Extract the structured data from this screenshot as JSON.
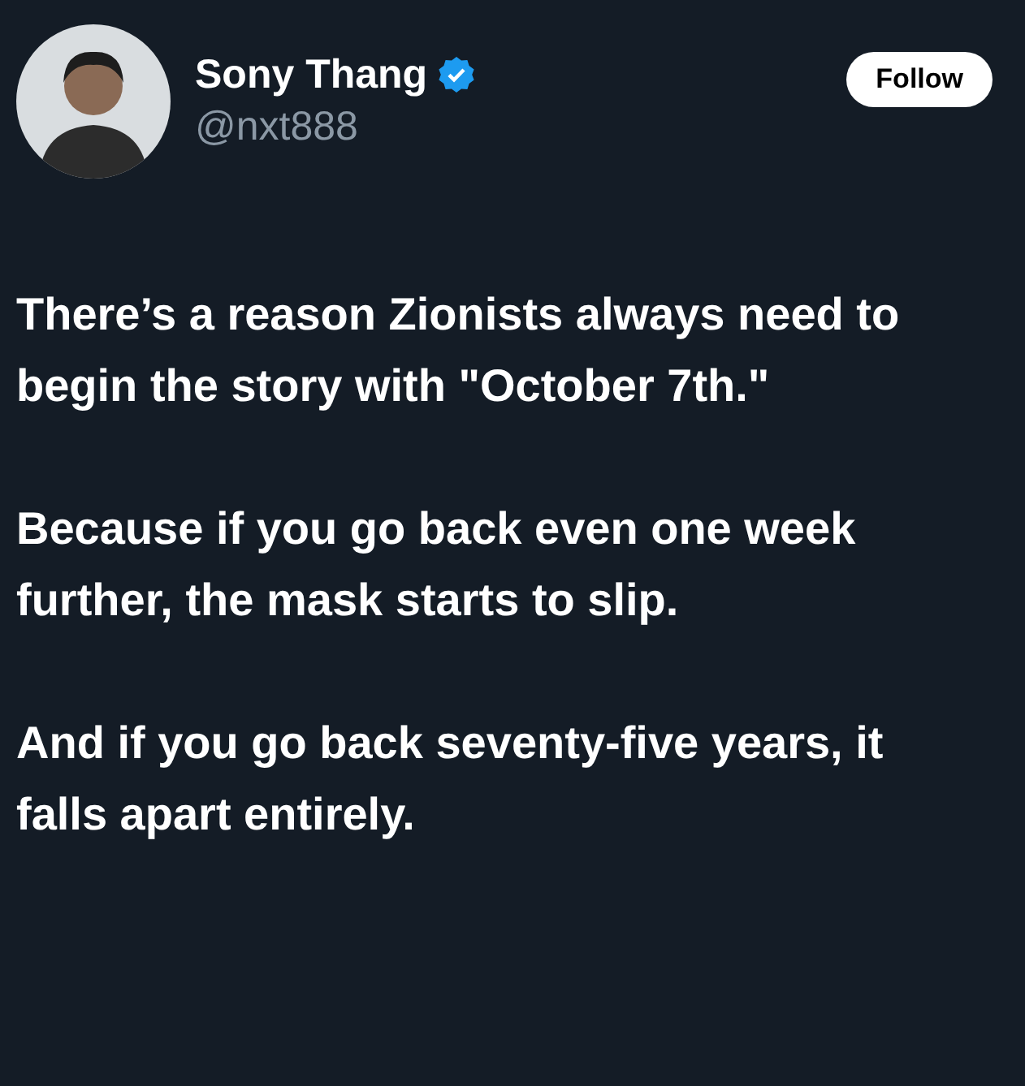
{
  "author": {
    "name": "Sony Thang",
    "verified": true,
    "handle": "@nxt888"
  },
  "follow_button": {
    "label": "Follow"
  },
  "paragraphs": [
    "There’s a reason Zionists always need to begin the story with \"October 7th.\"",
    "Because if you go back even one week further, the mask starts to slip.",
    "And if you go back seventy-five years, it falls apart entirely."
  ]
}
